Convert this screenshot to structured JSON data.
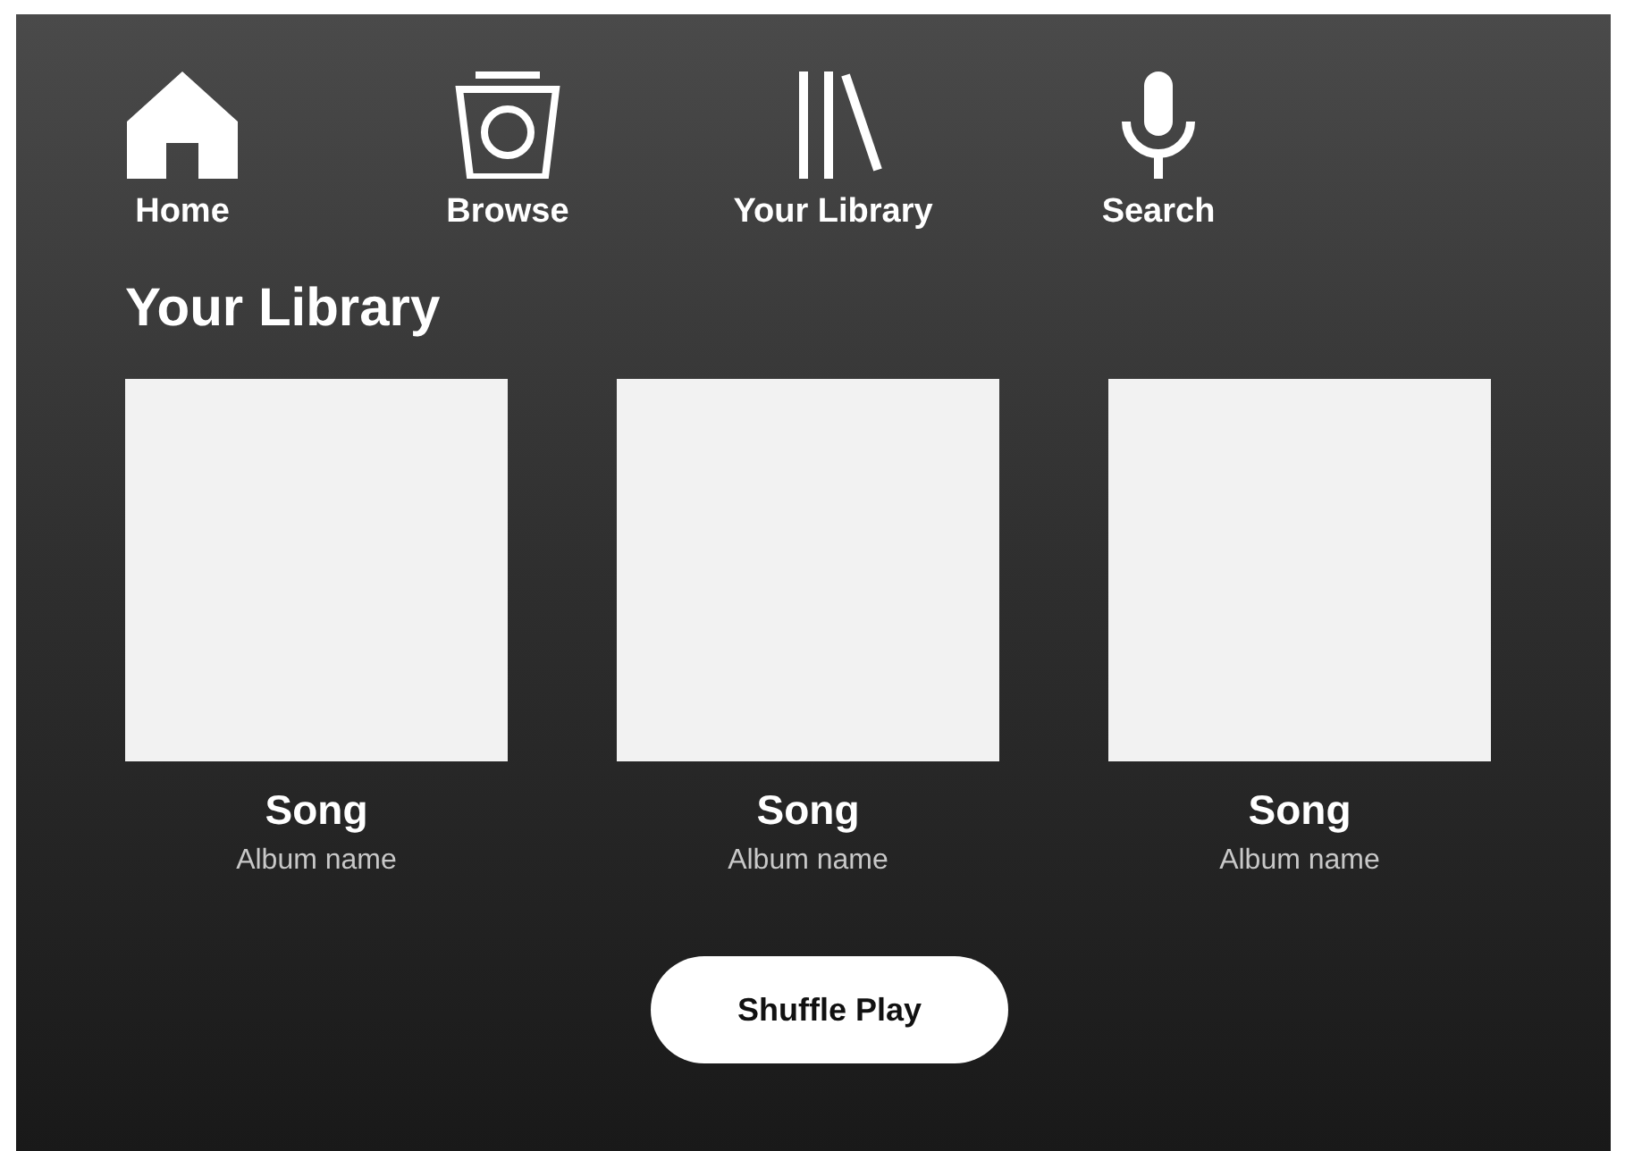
{
  "nav": [
    {
      "label": "Home"
    },
    {
      "label": "Browse"
    },
    {
      "label": "Your Library"
    },
    {
      "label": "Search"
    }
  ],
  "heading": "Your Library",
  "tracks": [
    {
      "title": "Song",
      "album": "Album name"
    },
    {
      "title": "Song",
      "album": "Album name"
    },
    {
      "title": "Song",
      "album": "Album name"
    }
  ],
  "button": "Shuffle Play"
}
